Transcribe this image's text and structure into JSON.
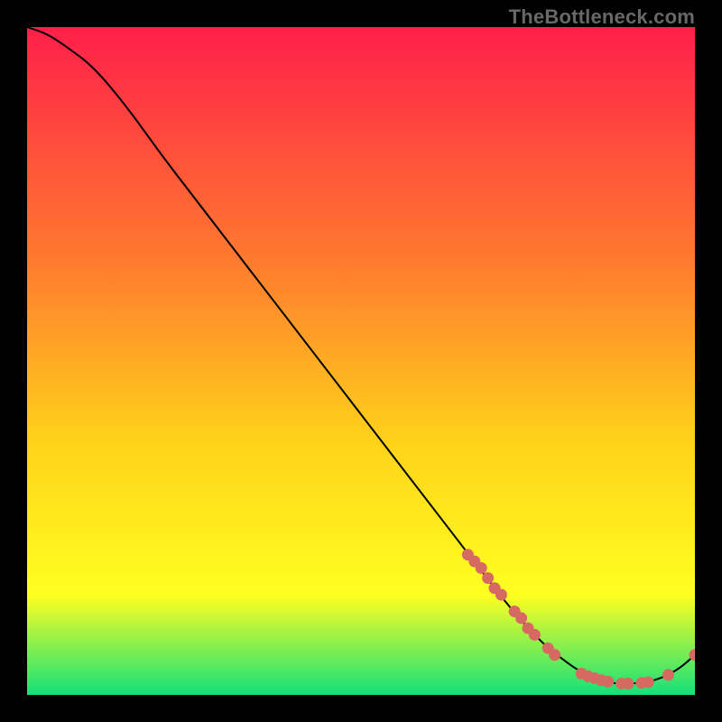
{
  "watermark": "TheBottleneck.com",
  "colors": {
    "background": "#000000",
    "gradient_top": "#ff1f4a",
    "gradient_mid1": "#ff7a2e",
    "gradient_mid2": "#ffd21a",
    "gradient_mid3": "#ffff20",
    "gradient_bottom": "#15e07a",
    "curve": "#000000",
    "marker": "#d66a63"
  },
  "chart_data": {
    "type": "line",
    "title": "",
    "xlabel": "",
    "ylabel": "",
    "xlim": [
      0,
      100
    ],
    "ylim": [
      0,
      100
    ],
    "note": "Axes are unlabeled in the image; x and y are normalized 0–100. Curve starts at top-left, falls steeply to a minimum near x≈88, then rises slightly at the right edge.",
    "series": [
      {
        "name": "curve",
        "x": [
          0,
          3,
          6,
          10,
          15,
          20,
          25,
          30,
          35,
          40,
          45,
          50,
          55,
          60,
          65,
          70,
          72,
          75,
          78,
          80,
          82,
          84,
          86,
          88,
          90,
          92,
          94,
          96,
          98,
          100
        ],
        "y": [
          100,
          99,
          97,
          94,
          88,
          81,
          74.5,
          68,
          61.5,
          55,
          48.5,
          42,
          35.5,
          29,
          22.5,
          16,
          13.5,
          10,
          7,
          5.5,
          4,
          3,
          2.2,
          1.7,
          1.7,
          1.8,
          2.2,
          3,
          4.2,
          6
        ]
      }
    ],
    "markers": {
      "name": "samples",
      "note": "Clusters of pink circular markers along the curve in the lower-right region.",
      "x": [
        66,
        67,
        68,
        69,
        70,
        71,
        73,
        74,
        75,
        76,
        78,
        79,
        83,
        84,
        85,
        86,
        87,
        89,
        90,
        92,
        93,
        96,
        100
      ],
      "y": [
        21,
        20,
        19,
        17.5,
        16,
        15,
        12.5,
        11.5,
        10,
        9,
        7,
        6,
        3.2,
        2.8,
        2.5,
        2.2,
        2.0,
        1.7,
        1.7,
        1.8,
        1.9,
        3.0,
        6
      ]
    }
  }
}
